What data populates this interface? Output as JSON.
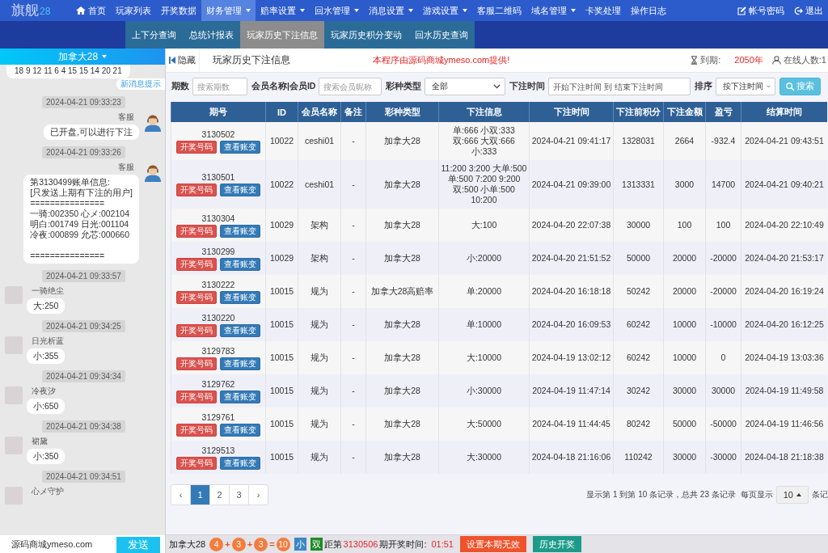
{
  "nav": {
    "brand": {
      "name": "旗舰",
      "suffix": "28"
    },
    "items": [
      {
        "label": "首页",
        "kind": "home",
        "dropdown": false,
        "selected": false
      },
      {
        "label": "玩家列表",
        "kind": "link",
        "dropdown": false,
        "selected": false
      },
      {
        "label": "开奖数据",
        "kind": "link",
        "dropdown": false,
        "selected": false
      },
      {
        "label": "财务管理",
        "kind": "link",
        "dropdown": true,
        "selected": true
      },
      {
        "label": "赔率设置",
        "kind": "link",
        "dropdown": true,
        "selected": false
      },
      {
        "label": "回水管理",
        "kind": "link",
        "dropdown": true,
        "selected": false
      },
      {
        "label": "消息设置",
        "kind": "link",
        "dropdown": true,
        "selected": false
      },
      {
        "label": "游戏设置",
        "kind": "link",
        "dropdown": true,
        "selected": false
      },
      {
        "label": "客服二维码",
        "kind": "link",
        "dropdown": false,
        "selected": false
      },
      {
        "label": "域名管理",
        "kind": "link",
        "dropdown": true,
        "selected": false
      },
      {
        "label": "卡奖处理",
        "kind": "link",
        "dropdown": false,
        "selected": false
      },
      {
        "label": "操作日志",
        "kind": "link",
        "dropdown": false,
        "selected": false
      }
    ],
    "account": [
      {
        "label": "帐号密码",
        "kind": "edit"
      },
      {
        "label": "退出",
        "kind": "logout"
      }
    ]
  },
  "subnav": {
    "tabs": [
      {
        "label": "上下分查询",
        "selected": false
      },
      {
        "label": "总统计报表",
        "selected": false
      },
      {
        "label": "玩家历史下注信息",
        "selected": true
      },
      {
        "label": "玩家历史积分变动",
        "selected": false
      },
      {
        "label": "回水历史查询",
        "selected": false
      }
    ]
  },
  "chat": {
    "header": "加拿大28",
    "messages": [
      {
        "kind": "fragment",
        "text": "18 9 12 11 6 4 15 15 14 20 21"
      },
      {
        "kind": "hint",
        "text": "新消息提示"
      },
      {
        "kind": "time",
        "text": "2024-04-21 09:33:23"
      },
      {
        "kind": "sent",
        "name": "客服",
        "text": "已开盘,可以进行下注"
      },
      {
        "kind": "time",
        "text": "2024-04-21 09:33:26"
      },
      {
        "kind": "sent",
        "name": "客服",
        "text": "第3130499账单信息:\n[只发送上期有下注的用户]\n===============\n一骑:002350 心メ:002104\n明白:001749 日光:001104\n冷夜:000899 允芯:000660\n\n==============="
      },
      {
        "kind": "time",
        "text": "2024-04-21 09:33:57"
      },
      {
        "kind": "received",
        "name": "一骑绝尘",
        "text": "大:250"
      },
      {
        "kind": "time",
        "text": "2024-04-21 09:34:25"
      },
      {
        "kind": "received",
        "name": "日光析蓝",
        "text": "小:355"
      },
      {
        "kind": "time",
        "text": "2024-04-21 09:34:34"
      },
      {
        "kind": "received",
        "name": "冷夜汐",
        "text": "小:650"
      },
      {
        "kind": "time",
        "text": "2024-04-21 09:34:38"
      },
      {
        "kind": "received",
        "name": "裙黛",
        "text": "小:350"
      },
      {
        "kind": "time",
        "text": "2024-04-21 09:34:51"
      },
      {
        "kind": "received",
        "name": "心メ守护"
      }
    ],
    "input": {
      "value": "源码商城ymeso.com"
    },
    "send_button": "发送"
  },
  "topbar": {
    "hide_button": "隐藏",
    "title": "玩家历史下注信息",
    "notice": "本程序由源码商城ymeso.com提供!",
    "expiry_label": "到期:",
    "expiry_value": "2050年",
    "online": "在线人数:1"
  },
  "filters": {
    "fields": [
      {
        "label": "期数",
        "kind": "text",
        "placeholder": "搜索期数"
      },
      {
        "label": "会员名称|会员ID",
        "kind": "text",
        "placeholder": "搜索会员昵称"
      },
      {
        "label": "彩种类型",
        "kind": "select",
        "value": "全部"
      },
      {
        "label": "下注时间",
        "kind": "range",
        "placeholder": "开始下注时间 到 结束下注时间"
      },
      {
        "label": "排序",
        "kind": "select",
        "value": "按下注时间"
      }
    ],
    "search_button": "搜索"
  },
  "table": {
    "columns": [
      "期号",
      "ID",
      "会员名称",
      "备注",
      "彩种类型",
      "下注信息",
      "下注时间",
      "下注前积分",
      "下注金额",
      "盈亏",
      "结算时间"
    ],
    "rows": [
      {
        "cells": [
          "3130502",
          "10022",
          "ceshi01",
          "-",
          "加拿大28",
          "单:666 小双:333\n双:666 大双:666\n小:333",
          "2024-04-21 09:41:17",
          "1328031",
          "2664",
          "-932.4",
          "2024-04-21 09:43:51"
        ],
        "buttons": [
          {
            "label": "开奖号码",
            "kind": "result"
          },
          {
            "label": "查看账变",
            "kind": "ledger"
          }
        ]
      },
      {
        "cells": [
          "3130501",
          "10022",
          "ceshi01",
          "-",
          "加拿大28",
          "11:200 3:200 大单:500\n单:500 7:200 9:200\n双:500 小单:500\n10:200",
          "2024-04-21 09:39:00",
          "1313331",
          "3000",
          "14700",
          "2024-04-21 09:40:21"
        ],
        "buttons": [
          {
            "label": "开奖号码",
            "kind": "result"
          },
          {
            "label": "查看账变",
            "kind": "ledger"
          }
        ]
      },
      {
        "cells": [
          "3130304",
          "10029",
          "架构",
          "-",
          "加拿大28",
          "大:100",
          "2024-04-20 22:07:38",
          "30000",
          "100",
          "100",
          "2024-04-20 22:10:49"
        ],
        "buttons": [
          {
            "label": "开奖号码",
            "kind": "result"
          },
          {
            "label": "查看账变",
            "kind": "ledger"
          }
        ]
      },
      {
        "cells": [
          "3130299",
          "10029",
          "架构",
          "-",
          "加拿大28",
          "小:20000",
          "2024-04-20 21:51:52",
          "50000",
          "20000",
          "-20000",
          "2024-04-20 21:53:17"
        ],
        "buttons": [
          {
            "label": "开奖号码",
            "kind": "result"
          },
          {
            "label": "查看账变",
            "kind": "ledger"
          }
        ]
      },
      {
        "cells": [
          "3130222",
          "10015",
          "规为",
          "-",
          "加拿大28高赔率",
          "单:20000",
          "2024-04-20 16:18:18",
          "50242",
          "20000",
          "-20000",
          "2024-04-20 16:19:24"
        ],
        "buttons": [
          {
            "label": "开奖号码",
            "kind": "result"
          },
          {
            "label": "查看账变",
            "kind": "ledger"
          }
        ]
      },
      {
        "cells": [
          "3130220",
          "10015",
          "规为",
          "-",
          "加拿大28",
          "单:10000",
          "2024-04-20 16:09:53",
          "60242",
          "10000",
          "-10000",
          "2024-04-20 16:12:25"
        ],
        "buttons": [
          {
            "label": "开奖号码",
            "kind": "result"
          },
          {
            "label": "查看账变",
            "kind": "ledger"
          }
        ]
      },
      {
        "cells": [
          "3129783",
          "10015",
          "规为",
          "-",
          "加拿大28",
          "大:10000",
          "2024-04-19 13:02:12",
          "60242",
          "10000",
          "0",
          "2024-04-19 13:03:36"
        ],
        "buttons": [
          {
            "label": "开奖号码",
            "kind": "result"
          },
          {
            "label": "查看账变",
            "kind": "ledger"
          }
        ]
      },
      {
        "cells": [
          "3129762",
          "10015",
          "规为",
          "-",
          "加拿大28",
          "小:30000",
          "2024-04-19 11:47:14",
          "30242",
          "30000",
          "30000",
          "2024-04-19 11:49:58"
        ],
        "buttons": [
          {
            "label": "开奖号码",
            "kind": "result"
          },
          {
            "label": "查看账变",
            "kind": "ledger"
          }
        ]
      },
      {
        "cells": [
          "3129761",
          "10015",
          "规为",
          "-",
          "加拿大28",
          "大:50000",
          "2024-04-19 11:44:45",
          "80242",
          "50000",
          "-50000",
          "2024-04-19 11:46:56"
        ],
        "buttons": [
          {
            "label": "开奖号码",
            "kind": "result"
          },
          {
            "label": "查看账变",
            "kind": "ledger"
          }
        ]
      },
      {
        "cells": [
          "3129513",
          "10015",
          "规为",
          "-",
          "加拿大28",
          "大:30000",
          "2024-04-18 21:16:06",
          "110242",
          "30000",
          "-30000",
          "2024-04-18 21:18:38"
        ],
        "buttons": [
          {
            "label": "开奖号码",
            "kind": "result"
          },
          {
            "label": "查看账变",
            "kind": "ledger"
          }
        ]
      }
    ]
  },
  "pagination": {
    "pages": [
      {
        "label": "‹",
        "selected": false
      },
      {
        "label": "1",
        "selected": true
      },
      {
        "label": "2",
        "selected": false
      },
      {
        "label": "3",
        "selected": false
      },
      {
        "label": "›",
        "selected": false
      }
    ],
    "summary": "显示第 1 到第 10 条记录，总共 23 条记录",
    "page_size_label": "每页显示",
    "page_size": "10",
    "page_size_suffix": "条记"
  },
  "draw_bar": {
    "game": "加拿大28",
    "numbers": [
      "4",
      "3",
      "3"
    ],
    "operators": [
      "+",
      "+",
      "="
    ],
    "sum": "10",
    "tags": [
      {
        "label": "小",
        "color": "#3c86c4"
      },
      {
        "label": "双",
        "color": "#1f8a23"
      }
    ],
    "prefix": "距第",
    "period": "3130506",
    "suffix": "期开奖时间:",
    "countdown": "01:51",
    "buttons": [
      {
        "label": "设置本期无效",
        "kind": "invalidate"
      },
      {
        "label": "历史开奖",
        "kind": "history"
      }
    ]
  }
}
